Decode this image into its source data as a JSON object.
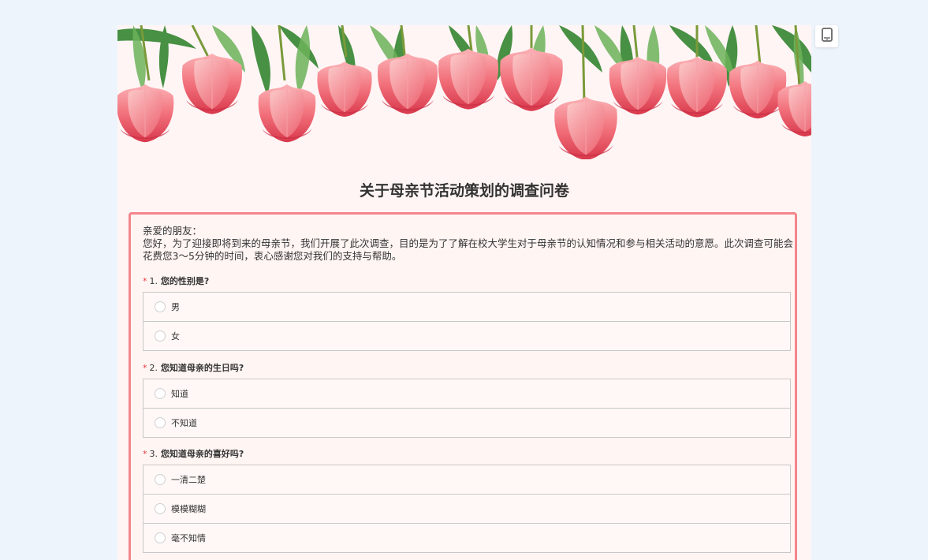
{
  "survey": {
    "title": "关于母亲节活动策划的调查问卷",
    "greeting": "亲爱的朋友：",
    "intro": "您好，为了迎接即将到来的母亲节，我们开展了此次调查，目的是为了了解在校大学生对于母亲节的认知情况和参与相关活动的意愿。此次调查可能会花费您3～5分钟的时间，衷心感谢您对我们的支持与帮助。",
    "required_mark": "*"
  },
  "toolbar": {
    "device_icon": "mobile-phone-icon"
  },
  "questions": [
    {
      "number": "1.",
      "text": "您的性别是?",
      "options": [
        "男",
        "女"
      ]
    },
    {
      "number": "2.",
      "text": "您知道母亲的生日吗?",
      "options": [
        "知道",
        "不知道"
      ]
    },
    {
      "number": "3.",
      "text": "您知道母亲的喜好吗?",
      "options": [
        "一清二楚",
        "模模糊糊",
        "毫不知情"
      ]
    }
  ],
  "colors": {
    "page_bg": "#eef4fc",
    "form_bg": "#fff5f5",
    "card_border": "#f2868b",
    "required": "#e4393c"
  }
}
